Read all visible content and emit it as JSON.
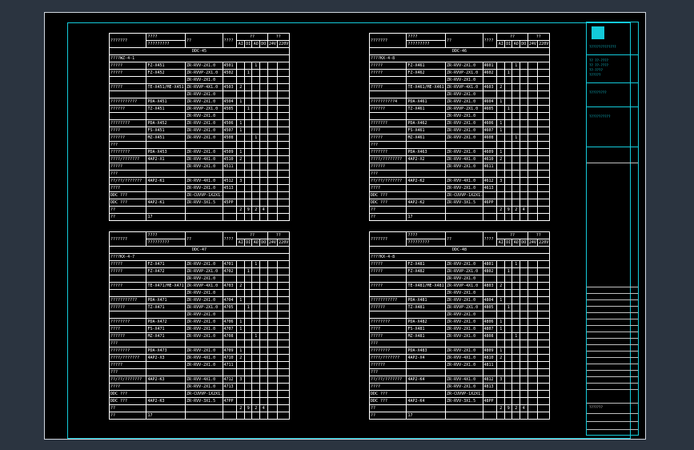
{
  "colors": {
    "frame": "#13c9d9",
    "sheet": "#000000",
    "ink": "#ffffff",
    "outer": "#2b3440"
  },
  "panels": [
    {
      "hdr1": [
        "???????",
        "????",
        "??",
        "????",
        "??",
        "??"
      ],
      "hdr2": [
        "?????????",
        "AI",
        "DI",
        "AO",
        "DO",
        "24V",
        "220V"
      ],
      "title": "DDC-45",
      "section": "????WZ-4-1",
      "rows": [
        [
          "?????",
          "FZ-X451",
          "ZR-RVV-2X1.0",
          "4501",
          "",
          "",
          "1",
          ""
        ],
        [
          "?????",
          "FZ-X452",
          "ZR-RVVP-2X1.0",
          "4502",
          "",
          "1",
          "",
          ""
        ],
        [
          "",
          "",
          "ZR-RVV-2X1.0",
          "",
          "",
          "",
          "",
          ""
        ],
        [
          "?????",
          "TE-X451/ME-X451",
          "ZR-RVVP-4X1.0",
          "4503",
          "2",
          "",
          "",
          ""
        ],
        [
          "",
          "",
          "ZR-RVV-2X1.0",
          "",
          "",
          "",
          "",
          ""
        ],
        [
          "???????????",
          "PDA-X451",
          "ZR-RVV-2X1.0",
          "4504",
          "1",
          "",
          "",
          ""
        ],
        [
          "??????",
          "TZ-X451",
          "ZR-RVVP-2X1.0",
          "4505",
          "",
          "1",
          "",
          ""
        ],
        [
          "",
          "",
          "ZR-RVV-2X1.0",
          "",
          "",
          "",
          "",
          ""
        ],
        [
          "????????",
          "PDA-X452",
          "ZR-RVV-2X1.0",
          "4506",
          "1",
          "",
          "",
          ""
        ],
        [
          "????",
          "FS-X451",
          "ZR-RVV-2X1.0",
          "4507",
          "1",
          "",
          "",
          ""
        ],
        [
          "??????",
          "MZ-X451",
          "ZR-RVV-2X1.0",
          "4508",
          "",
          "",
          "1",
          ""
        ],
        [
          "???",
          "",
          "",
          "",
          "",
          "",
          "",
          ""
        ],
        [
          "????????",
          "PDA-X453",
          "ZR-RVV-2X1.0",
          "4509",
          "1",
          "",
          "",
          ""
        ],
        [
          "????/???????",
          "4AP2-X1",
          "ZR-RVV-4X1.0",
          "4510",
          "2",
          "",
          "",
          ""
        ],
        [
          "?????",
          "",
          "ZR-RVV-2X1.0",
          "4511",
          "",
          "",
          "",
          ""
        ],
        [
          "???",
          "",
          "",
          "",
          "",
          "",
          "",
          ""
        ],
        [
          "??/??/???????",
          "4AP2-K1",
          "ZR-RVV-4X1.0",
          "4512",
          "3",
          "",
          "",
          ""
        ],
        [
          "????",
          "",
          "ZR-RVV-2X1.0",
          "4513",
          "",
          "",
          "",
          ""
        ],
        [
          "DDC ???",
          "",
          "ZR-CUVVP-1X2X1.0",
          "",
          "",
          "",
          "",
          ""
        ],
        [
          "DDC ???",
          "4AP2-K1",
          "ZR-RVV-3X1.5",
          "45PP",
          "",
          "",
          "",
          ""
        ],
        [
          "??",
          "",
          "",
          "",
          "2",
          "9",
          "2",
          "4"
        ],
        [
          "??",
          "17",
          "",
          "",
          "",
          "",
          "",
          ""
        ]
      ]
    },
    {
      "hdr1": [
        "???????",
        "????",
        "??",
        "????",
        "??",
        "??"
      ],
      "hdr2": [
        "?????????",
        "AI",
        "DI",
        "AO",
        "DO",
        "24V",
        "220V"
      ],
      "title": "DDC-46",
      "section": "????KX-4-8",
      "rows": [
        [
          "?????",
          "FZ-X461",
          "ZR-RVV-2X1.0",
          "4601",
          "",
          "",
          "1",
          ""
        ],
        [
          "?????",
          "FZ-X462",
          "ZR-RVVP-2X1.0",
          "4602",
          "",
          "1",
          "",
          ""
        ],
        [
          "",
          "",
          "ZR-RVV-2X1.0",
          "",
          "",
          "",
          "",
          ""
        ],
        [
          "?????",
          "TE-X461/ME-X461",
          "ZR-RVVP-4X1.0",
          "4603",
          "2",
          "",
          "",
          ""
        ],
        [
          "",
          "",
          "ZR-RVV-2X1.0",
          "",
          "",
          "",
          "",
          ""
        ],
        [
          "??????????4",
          "PDA-X461",
          "ZR-RVV-2X1.0",
          "4604",
          "1",
          "",
          "",
          ""
        ],
        [
          "??????",
          "TZ-X461",
          "ZR-RVVP-2X1.0",
          "4605",
          "",
          "1",
          "",
          ""
        ],
        [
          "",
          "",
          "ZR-RVV-2X1.0",
          "",
          "",
          "",
          "",
          ""
        ],
        [
          "???????",
          "PDA-X462",
          "ZR-RVV-2X1.0",
          "4606",
          "1",
          "",
          "",
          ""
        ],
        [
          "????",
          "FS-X461",
          "ZR-RVV-2X1.0",
          "4607",
          "1",
          "",
          "",
          ""
        ],
        [
          "?????",
          "MZ-X461",
          "ZR-RVV-2X1.0",
          "4608",
          "",
          "",
          "1",
          ""
        ],
        [
          "???",
          "",
          "",
          "",
          "",
          "",
          "",
          ""
        ],
        [
          "???????",
          "PDA-X463",
          "ZR-RVV-2X1.0",
          "4609",
          "1",
          "",
          "",
          ""
        ],
        [
          "????/????????",
          "4AP2-X2",
          "ZR-RVV-4X1.0",
          "4610",
          "2",
          "",
          "",
          ""
        ],
        [
          "??????",
          "",
          "ZR-RVV-2X1.0",
          "4611",
          "",
          "",
          "",
          ""
        ],
        [
          "???",
          "",
          "",
          "",
          "",
          "",
          "",
          ""
        ],
        [
          "??/??/???????",
          "4AP2-K2",
          "ZR-RVV-4X1.0",
          "4612",
          "3",
          "",
          "",
          ""
        ],
        [
          "????",
          "",
          "ZR-RVV-2X1.0",
          "4613",
          "",
          "",
          "",
          ""
        ],
        [
          "DDC ???",
          "",
          "ZR-CUVVP-1X2X1.0",
          "",
          "",
          "",
          "",
          ""
        ],
        [
          "DDC ???",
          "4AP2-K2",
          "ZR-RVV-3X1.5",
          "46PP",
          "",
          "",
          "",
          ""
        ],
        [
          "??",
          "",
          "",
          "",
          "2",
          "9",
          "2",
          "4"
        ],
        [
          "??",
          "17",
          "",
          "",
          "",
          "",
          "",
          ""
        ]
      ]
    },
    {
      "hdr1": [
        "???????",
        "????",
        "??",
        "????",
        "??",
        "??"
      ],
      "hdr2": [
        "?????????",
        "AI",
        "DI",
        "AO",
        "DO",
        "24V",
        "220V"
      ],
      "title": "DDC-47",
      "section": "????KX-4-7",
      "rows": [
        [
          "?????",
          "FZ-X471",
          "ZR-RVV-2X1.0",
          "4701",
          "",
          "",
          "1",
          ""
        ],
        [
          "?????",
          "FZ-X472",
          "ZR-RVVP-2X1.0",
          "4702",
          "",
          "1",
          "",
          ""
        ],
        [
          "",
          "",
          "ZR-RVV-2X1.0",
          "",
          "",
          "",
          "",
          ""
        ],
        [
          "?????",
          "TE-X471/ME-X471",
          "ZR-RVVP-4X1.0",
          "4703",
          "2",
          "",
          "",
          ""
        ],
        [
          "",
          "",
          "ZR-RVV-2X1.0",
          "",
          "",
          "",
          "",
          ""
        ],
        [
          "???????????",
          "PDA-X471",
          "ZR-RVV-2X1.0",
          "4704",
          "1",
          "",
          "",
          ""
        ],
        [
          "??????",
          "TZ-X471",
          "ZR-RVVP-2X1.0",
          "4705",
          "",
          "1",
          "",
          ""
        ],
        [
          "",
          "",
          "ZR-RVV-2X1.0",
          "",
          "",
          "",
          "",
          ""
        ],
        [
          "????????",
          "PDA-X472",
          "ZR-RVV-2X1.0",
          "4706",
          "1",
          "",
          "",
          ""
        ],
        [
          "????",
          "FS-X471",
          "ZR-RVV-2X1.0",
          "4707",
          "1",
          "",
          "",
          ""
        ],
        [
          "??????",
          "MZ-X471",
          "ZR-RVV-2X1.0",
          "4708",
          "",
          "",
          "1",
          ""
        ],
        [
          "???",
          "",
          "",
          "",
          "",
          "",
          "",
          ""
        ],
        [
          "????????",
          "PDA-X473",
          "ZR-RVV-2X1.0",
          "4709",
          "1",
          "",
          "",
          ""
        ],
        [
          "????/???????",
          "4AP2-X3",
          "ZR-RVV-4X1.0",
          "4710",
          "2",
          "",
          "",
          ""
        ],
        [
          "?????",
          "",
          "ZR-RVV-2X1.0",
          "4711",
          "",
          "",
          "",
          ""
        ],
        [
          "???",
          "",
          "",
          "",
          "",
          "",
          "",
          ""
        ],
        [
          "??/??/???????",
          "4AP2-K3",
          "ZR-RVV-4X1.0",
          "4712",
          "3",
          "",
          "",
          ""
        ],
        [
          "????",
          "",
          "ZR-RVV-2X1.0",
          "4713",
          "",
          "",
          "",
          ""
        ],
        [
          "DDC ???",
          "",
          "ZR-CUVVP-1X2X1.0",
          "",
          "",
          "",
          "",
          ""
        ],
        [
          "DDC ???",
          "4AP2-K3",
          "ZR-RVV-3X1.5",
          "47PP",
          "",
          "",
          "",
          ""
        ],
        [
          "??",
          "",
          "",
          "",
          "2",
          "9",
          "2",
          "4"
        ],
        [
          "??",
          "17",
          "",
          "",
          "",
          "",
          "",
          ""
        ]
      ]
    },
    {
      "hdr1": [
        "???????",
        "????",
        "??",
        "????",
        "??",
        "??"
      ],
      "hdr2": [
        "?????????",
        "AI",
        "DI",
        "AO",
        "DO",
        "24V",
        "220V"
      ],
      "title": "DDC-48",
      "section": "????KX-4-8",
      "rows": [
        [
          "?????",
          "FZ-X481",
          "ZR-RVV-2X1.0",
          "4801",
          "",
          "",
          "1",
          ""
        ],
        [
          "?????",
          "FZ-X482",
          "ZR-RVVP-2X1.0",
          "4802",
          "",
          "1",
          "",
          ""
        ],
        [
          "",
          "",
          "ZR-RVV-2X1.0",
          "",
          "",
          "",
          "",
          ""
        ],
        [
          "?????",
          "TE-X481/ME-X481",
          "ZR-RVVP-4X1.0",
          "4803",
          "2",
          "",
          "",
          ""
        ],
        [
          "",
          "",
          "ZR-RVV-2X1.0",
          "",
          "",
          "",
          "",
          ""
        ],
        [
          "???????????",
          "PDA-X481",
          "ZR-RVV-2X1.0",
          "4804",
          "1",
          "",
          "",
          ""
        ],
        [
          "??????",
          "TZ-X481",
          "ZR-RVVP-2X1.0",
          "4805",
          "",
          "1",
          "",
          ""
        ],
        [
          "",
          "",
          "ZR-RVV-2X1.0",
          "",
          "",
          "",
          "",
          ""
        ],
        [
          "????????",
          "PDA-X482",
          "ZR-RVV-2X1.0",
          "4806",
          "1",
          "",
          "",
          ""
        ],
        [
          "????",
          "FS-X481",
          "ZR-RVV-2X1.0",
          "4807",
          "1",
          "",
          "",
          ""
        ],
        [
          "?????",
          "MZ-X481",
          "ZR-RVV-2X1.0",
          "4808",
          "",
          "",
          "1",
          ""
        ],
        [
          "???",
          "",
          "",
          "",
          "",
          "",
          "",
          ""
        ],
        [
          "????????",
          "PDA-X483",
          "ZR-RVV-2X1.0",
          "4809",
          "1",
          "",
          "",
          ""
        ],
        [
          "????/???????",
          "4AP2-X4",
          "ZR-RVV-4X1.0",
          "4810",
          "2",
          "",
          "",
          ""
        ],
        [
          "??????",
          "",
          "ZR-RVV-2X1.0",
          "4811",
          "",
          "",
          "",
          ""
        ],
        [
          "???",
          "",
          "",
          "",
          "",
          "",
          "",
          ""
        ],
        [
          "??/??/???????",
          "4AP2-K4",
          "ZR-RVV-4X1.0",
          "4812",
          "3",
          "",
          "",
          ""
        ],
        [
          "????",
          "",
          "ZR-RVV-2X1.0",
          "4813",
          "",
          "",
          "",
          ""
        ],
        [
          "DDC ???",
          "",
          "ZR-CUVVP-1X2X1.0",
          "",
          "",
          "",
          "",
          ""
        ],
        [
          "DDC ???",
          "4AP2-K4",
          "ZR-RVV-3X1.5",
          "48PP",
          "",
          "",
          "",
          ""
        ],
        [
          "??",
          "",
          "",
          "",
          "2",
          "9",
          "2",
          "4"
        ],
        [
          "??",
          "17",
          "",
          "",
          "",
          "",
          "",
          ""
        ]
      ]
    }
  ],
  "title_block": {
    "company": "??????????????",
    "company_en": "",
    "lines": [
      "?? ??-????",
      "?? ??-????",
      "??-????",
      "??????"
    ],
    "project": "?????????",
    "drawing": "???????????",
    "drawing_no": "???????",
    "scale": "",
    "date": ""
  }
}
